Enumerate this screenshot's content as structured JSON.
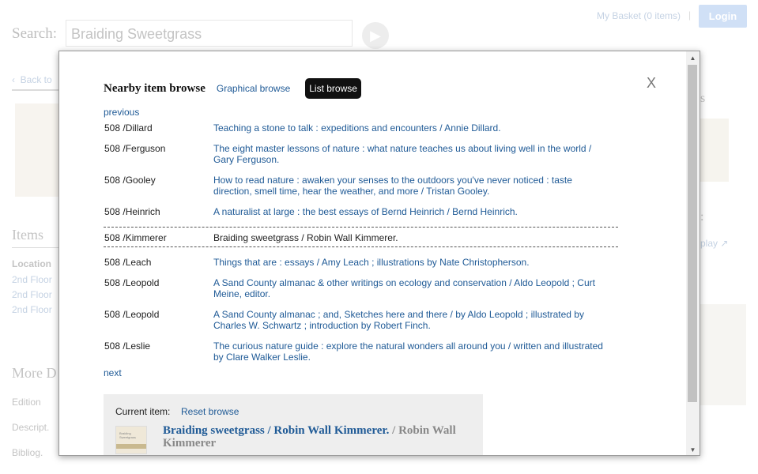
{
  "background": {
    "search_label": "Search:",
    "search_value": "Braiding Sweetgrass",
    "basket": "My Basket (0 items)",
    "separator": "|",
    "login": "Login",
    "back": "Back to",
    "items_heading": "Items",
    "location_label": "Location",
    "floors": [
      "2nd Floor",
      "2nd Floor",
      "2nd Floor"
    ],
    "more_heading": "More D",
    "fields": [
      "Edition",
      "Descript.",
      "Bibliog."
    ],
    "right_heading": "s",
    "right_colon": ":",
    "right_display": "play"
  },
  "modal": {
    "title": "Nearby item browse",
    "graphical_browse": "Graphical browse",
    "list_browse": "List browse",
    "close": "X",
    "previous": "previous",
    "next": "next",
    "items": [
      {
        "callno": "508 /Dillard",
        "title": "Teaching a stone to talk : expeditions and encounters / Annie Dillard."
      },
      {
        "callno": "508 /Ferguson",
        "title": "The eight master lessons of nature : what nature teaches us about living well in the world / Gary Ferguson."
      },
      {
        "callno": "508 /Gooley",
        "title": "How to read nature : awaken your senses to the outdoors you've never noticed : taste direction, smell time, hear the weather, and more / Tristan Gooley."
      },
      {
        "callno": "508 /Heinrich",
        "title": "A naturalist at large : the best essays of Bernd Heinrich / Bernd Heinrich."
      },
      {
        "callno": "508 /Kimmerer",
        "title": "Braiding sweetgrass / Robin Wall Kimmerer."
      },
      {
        "callno": "508 /Leach",
        "title": "Things that are : essays / Amy Leach ; illustrations by Nate Christopherson."
      },
      {
        "callno": "508 /Leopold",
        "title": "A Sand County almanac & other writings on ecology and conservation / Aldo Leopold ; Curt Meine, editor."
      },
      {
        "callno": "508 /Leopold",
        "title": "A Sand County almanac ; and, Sketches here and there / by Aldo Leopold ; illustrated by Charles W. Schwartz ; introduction by Robert Finch."
      },
      {
        "callno": "508 /Leslie",
        "title": "The curious nature guide : explore the natural wonders all around you / written and illustrated by Clare Walker Leslie."
      }
    ],
    "current_label": "Current item:",
    "reset_browse": "Reset browse",
    "current_title": "Braiding sweetgrass / Robin Wall Kimmerer.",
    "current_author": " / Robin Wall Kimmerer",
    "thumb_text": "Braiding Sweetgrass"
  }
}
